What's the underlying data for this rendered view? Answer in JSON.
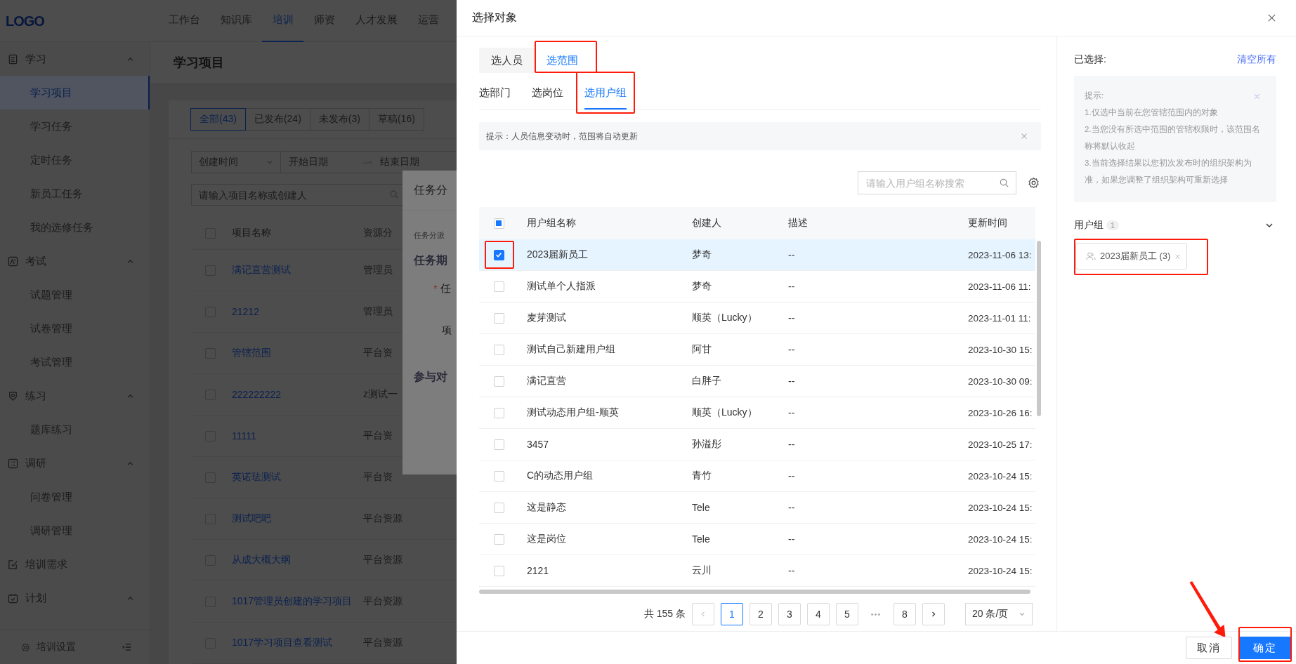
{
  "background": {
    "logo": "LOGO",
    "nav": [
      {
        "label": "工作台",
        "selected": false
      },
      {
        "label": "知识库",
        "selected": false
      },
      {
        "label": "培训",
        "selected": true
      },
      {
        "label": "师资",
        "selected": false
      },
      {
        "label": "人才发展",
        "selected": false
      },
      {
        "label": "运营",
        "selected": false
      }
    ],
    "sidebar": [
      {
        "kind": "group",
        "label": "学习",
        "expanded": true,
        "children": [
          {
            "label": "学习项目",
            "selected": true
          },
          {
            "label": "学习任务",
            "selected": false
          },
          {
            "label": "定时任务",
            "selected": false
          },
          {
            "label": "新员工任务",
            "selected": false
          },
          {
            "label": "我的选修任务",
            "selected": false
          }
        ]
      },
      {
        "kind": "group",
        "label": "考试",
        "expanded": true,
        "children": [
          {
            "label": "试题管理",
            "selected": false
          },
          {
            "label": "试卷管理",
            "selected": false
          },
          {
            "label": "考试管理",
            "selected": false
          }
        ]
      },
      {
        "kind": "group",
        "label": "练习",
        "expanded": true,
        "children": [
          {
            "label": "题库练习",
            "selected": false
          }
        ]
      },
      {
        "kind": "group",
        "label": "调研",
        "expanded": true,
        "children": [
          {
            "label": "问卷管理",
            "selected": false
          },
          {
            "label": "调研管理",
            "selected": false
          }
        ]
      },
      {
        "kind": "link",
        "label": "培训需求"
      },
      {
        "kind": "group",
        "label": "计划",
        "expanded": true
      }
    ],
    "sidebar_footer": "培训设置",
    "page_title": "学习项目",
    "status_tabs": [
      {
        "label": "全部(43)",
        "selected": true
      },
      {
        "label": "已发布(24)",
        "selected": false
      },
      {
        "label": "未发布(3)",
        "selected": false
      },
      {
        "label": "草稿(16)",
        "selected": false
      }
    ],
    "date_filter": {
      "field": "创建时间",
      "start_placeholder": "开始日期",
      "end_placeholder": "结束日期"
    },
    "search": {
      "placeholder": "请输入项目名称或创建人"
    },
    "table": {
      "columns": [
        "项目名称",
        "资源分"
      ],
      "all_checked": false,
      "rows": [
        {
          "name": "满记直营测试",
          "category": "管理员",
          "checked": false
        },
        {
          "name": "21212",
          "category": "管理员",
          "checked": false
        },
        {
          "name": "管辖范围",
          "category": "平台资",
          "checked": false
        },
        {
          "name": "222222222",
          "category": "z测试一",
          "checked": false
        },
        {
          "name": "11111",
          "category": "平台资",
          "checked": false
        },
        {
          "name": "英诺珐测试",
          "category": "平台资",
          "checked": false
        },
        {
          "name": "测试吧吧",
          "category": "平台资源",
          "checked": false
        },
        {
          "name": "从成大概大纲",
          "category": "平台资源",
          "checked": false
        },
        {
          "name": "1017管理员创建的学习项目",
          "category": "平台资源",
          "checked": false
        },
        {
          "name": "1017学习项目查看测试",
          "category": "平台资源",
          "checked": false
        }
      ]
    },
    "dialog": {
      "title": "任务分",
      "hint": "任务分派",
      "section": "任务期",
      "required_mark": "*",
      "required_label": "任",
      "label": "项",
      "section_2": "参与对"
    }
  },
  "drawer": {
    "title": "选择对象",
    "mode_tabs": [
      {
        "label": "选人员",
        "selected": false,
        "highlighted": false
      },
      {
        "label": "选范围",
        "selected": true,
        "highlighted": true
      }
    ],
    "scope_tabs": [
      {
        "label": "选部门",
        "selected": false,
        "highlighted": false
      },
      {
        "label": "选岗位",
        "selected": false,
        "highlighted": false
      },
      {
        "label": "选用户组",
        "selected": true,
        "highlighted": true
      }
    ],
    "notice": "提示：人员信息变动时，范围将自动更新",
    "search": {
      "placeholder": "请输入用户组名称搜索"
    },
    "table": {
      "columns": [
        "用户组名称",
        "创建人",
        "描述",
        "更新时间"
      ],
      "header_indeterminate": true,
      "rows": [
        {
          "name": "2023届新员工",
          "creator": "梦奇",
          "description": "--",
          "updated": "2023-11-06 13:",
          "checked": true,
          "highlighted": true
        },
        {
          "name": "测试单个人指派",
          "creator": "梦奇",
          "description": "--",
          "updated": "2023-11-06 11:",
          "checked": false,
          "highlighted": false
        },
        {
          "name": "麦芽测试",
          "creator": "顺英（Lucky）",
          "description": "--",
          "updated": "2023-11-01 11:",
          "checked": false,
          "highlighted": false
        },
        {
          "name": "测试自己新建用户组",
          "creator": "阿甘",
          "description": "--",
          "updated": "2023-10-30 15:",
          "checked": false,
          "highlighted": false
        },
        {
          "name": "满记直营",
          "creator": "白胖子",
          "description": "--",
          "updated": "2023-10-30 09:",
          "checked": false,
          "highlighted": false
        },
        {
          "name": "测试动态用户组-顺英",
          "creator": "顺英（Lucky）",
          "description": "--",
          "updated": "2023-10-26 16:",
          "checked": false,
          "highlighted": false
        },
        {
          "name": "3457",
          "creator": "孙溢彤",
          "description": "--",
          "updated": "2023-10-25 17:",
          "checked": false,
          "highlighted": false
        },
        {
          "name": "C的动态用户组",
          "creator": "青竹",
          "description": "--",
          "updated": "2023-10-24 15:",
          "checked": false,
          "highlighted": false
        },
        {
          "name": "这是静态",
          "creator": "Tele",
          "description": "--",
          "updated": "2023-10-24 15:",
          "checked": false,
          "highlighted": false
        },
        {
          "name": "这是岗位",
          "creator": "Tele",
          "description": "--",
          "updated": "2023-10-24 15:",
          "checked": false,
          "highlighted": false
        },
        {
          "name": "2121",
          "creator": "云川",
          "description": "--",
          "updated": "2023-10-24 15:",
          "checked": false,
          "highlighted": false
        }
      ]
    },
    "pagination": {
      "total": "共 155 条",
      "prev_disabled": true,
      "next_disabled": false,
      "pages": [
        {
          "kind": "page",
          "label": "1",
          "selected": true
        },
        {
          "kind": "page",
          "label": "2",
          "selected": false
        },
        {
          "kind": "page",
          "label": "3",
          "selected": false
        },
        {
          "kind": "page",
          "label": "4",
          "selected": false
        },
        {
          "kind": "page",
          "label": "5",
          "selected": false
        },
        {
          "kind": "ellipsis",
          "label": "•••",
          "selected": false
        },
        {
          "kind": "page",
          "label": "8",
          "selected": false
        }
      ],
      "page_size": "20 条/页"
    },
    "selected_panel": {
      "title": "已选择:",
      "clear": "清空所有",
      "tips": [
        "提示:",
        "1.仅选中当前在您管辖范围内的对象",
        "2.当您没有所选中范围的管辖权限时，该范围名称将默认收起",
        "3.当前选择结果以您初次发布时的组织架构为准，如果您调整了组织架构可重新选择"
      ],
      "group": {
        "label": "用户组",
        "count": "1",
        "expanded": true,
        "tags": [
          {
            "label": "2023届新员工 (3)",
            "highlighted": true
          }
        ]
      }
    },
    "buttons": [
      {
        "kind": "default",
        "label": "取消",
        "highlighted": false
      },
      {
        "kind": "primary",
        "label": "确定",
        "highlighted": true
      }
    ]
  }
}
